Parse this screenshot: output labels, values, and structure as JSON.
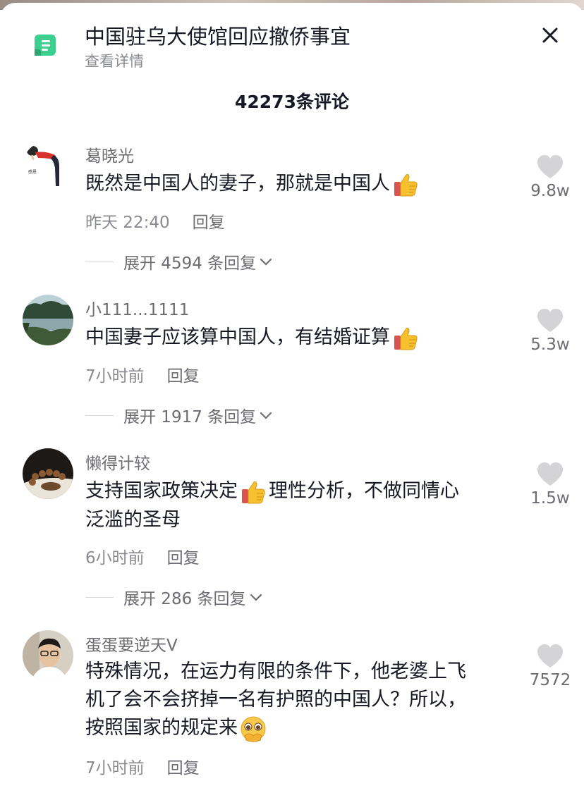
{
  "header": {
    "topic_title": "中国驻乌大使馆回应撤侨事宜",
    "topic_sub": "查看详情",
    "comment_count": "42273条评论"
  },
  "comments": [
    {
      "username": "葛晓光",
      "text_before": "既然是中国人的妻子，那就是中国人",
      "emoji1": "thumbs-up",
      "text_after": "",
      "text_line2": "",
      "time": "昨天 22:40",
      "reply_label": "回复",
      "expand": "展开 4594 条回复",
      "likes": "9.8w",
      "avatar_text": "感恩"
    },
    {
      "username": "小111...1111",
      "text_before": "中国妻子应该算中国人，有结婚证算",
      "emoji1": "thumbs-up",
      "text_after": "",
      "text_line2": "",
      "time": "7小时前",
      "reply_label": "回复",
      "expand": "展开 1917 条回复",
      "likes": "5.3w"
    },
    {
      "username": "懒得计较",
      "text_before": "支持国家政策决定",
      "emoji1": "thumbs-up",
      "text_after": "理性分析，不做同情心",
      "text_line2": "泛滥的圣母",
      "time": "6小时前",
      "reply_label": "回复",
      "expand": "展开 286 条回复",
      "likes": "1.5w"
    },
    {
      "username": "蛋蛋要逆天V",
      "text_line1": "特殊情况，在运力有限的条件下，他老婆上飞",
      "text_line2": "机了会不会挤掉一名有护照的中国人？所以，",
      "text_line3": "按照国家的规定来",
      "emoji1": "pleading-face",
      "time": "7小时前",
      "reply_label": "回复",
      "likes": "7572"
    }
  ],
  "icons": {
    "topic": "topic-doc-icon",
    "close": "close-icon",
    "like": "heart-icon",
    "expand": "chevron-down-icon"
  },
  "colors": {
    "topic_icon": "#3ccf8e",
    "text_primary": "#161823",
    "text_secondary": "#8a8b91",
    "heart": "#d4d4d6"
  }
}
